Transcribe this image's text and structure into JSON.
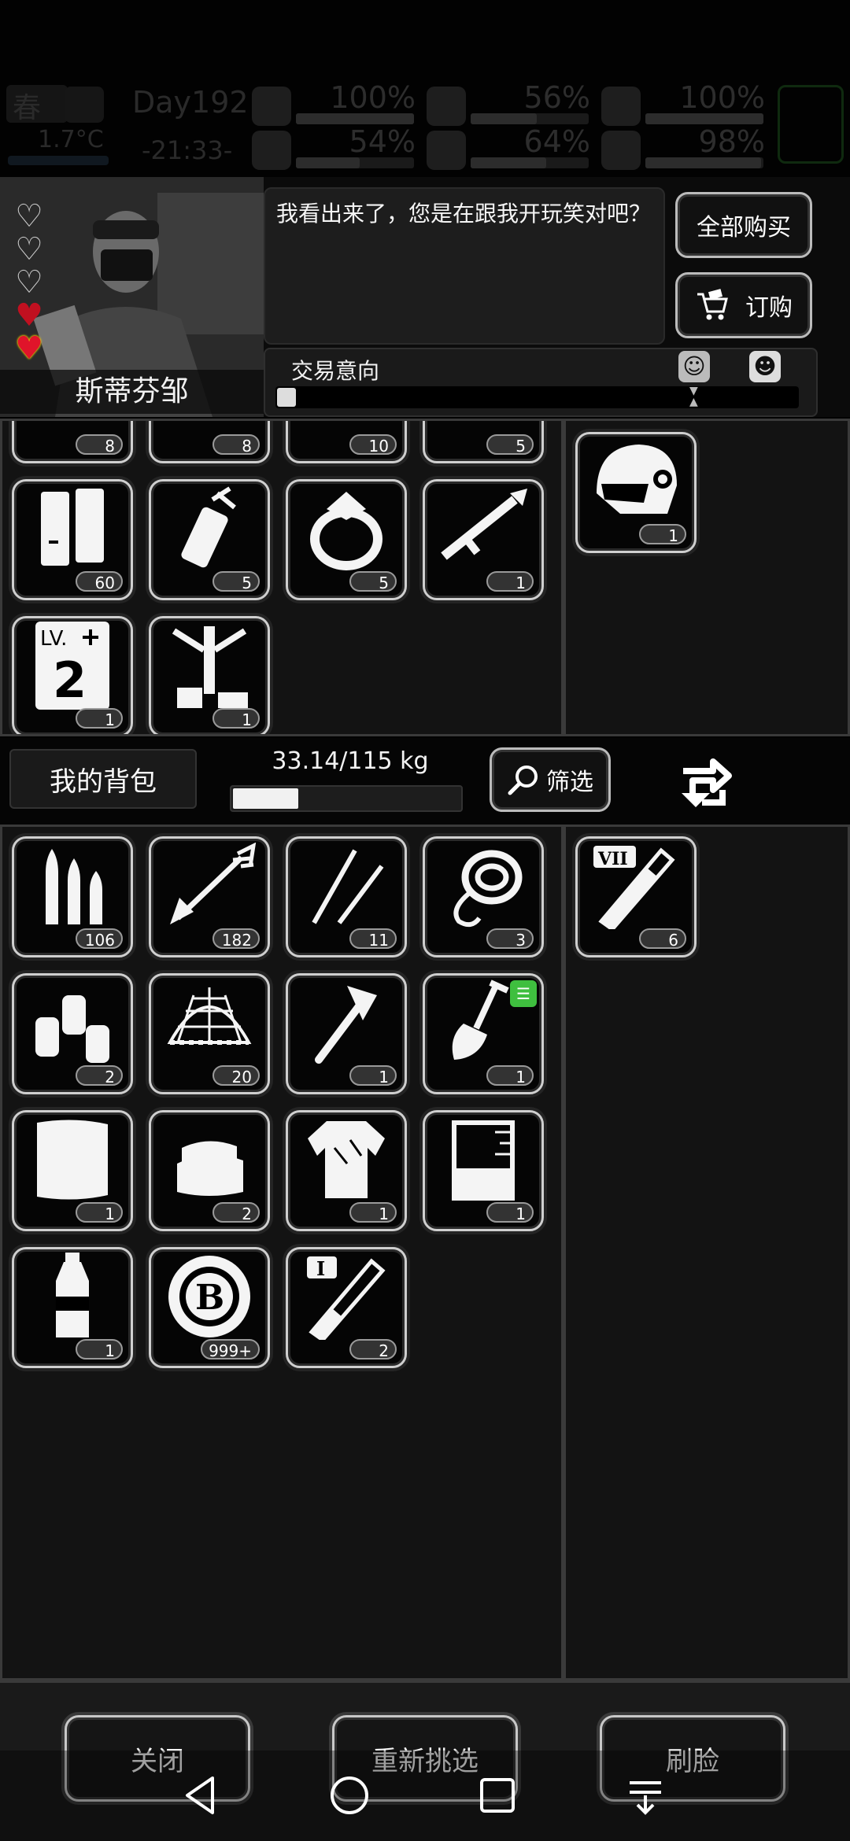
{
  "status": {
    "season": "春",
    "temperature": "1.7°C",
    "day": "Day192",
    "time": "-21:33-",
    "stats": [
      {
        "icon": "medkit-icon",
        "percent": "100%",
        "level": 1.0
      },
      {
        "icon": "stomach-icon",
        "percent": "56%",
        "level": 0.56
      },
      {
        "icon": "pill-icon",
        "percent": "100%",
        "level": 1.0
      },
      {
        "icon": "boot-icon",
        "percent": "54%",
        "level": 0.54
      },
      {
        "icon": "water-drop-icon",
        "percent": "64%",
        "level": 0.64
      },
      {
        "icon": "heart-icon",
        "percent": "98%",
        "level": 0.98
      }
    ]
  },
  "npc": {
    "name": "斯蒂芬邹",
    "dialog": "我看出来了，您是在跟我开玩笑对吧？",
    "hearts_filled": 2,
    "hearts_total": 5,
    "buy_all_label": "全部购买",
    "order_label": "订购",
    "intent_label": "交易意向",
    "intent_level": 0.03
  },
  "trader_items": [
    {
      "icon": "partial-item-icon",
      "count": "8"
    },
    {
      "icon": "partial-item-icon",
      "count": "8"
    },
    {
      "icon": "partial-item-icon",
      "count": "10"
    },
    {
      "icon": "partial-item-icon",
      "count": "5"
    },
    {
      "icon": "battery-icon",
      "count": "60"
    },
    {
      "icon": "grenade-icon",
      "count": "5"
    },
    {
      "icon": "ring-icon",
      "count": "5"
    },
    {
      "icon": "rocket-launcher-icon",
      "count": "1"
    },
    {
      "icon": "manual-lv2-icon",
      "count": "1",
      "label": "LV. 2"
    },
    {
      "icon": "tool-kit-icon",
      "count": "1"
    }
  ],
  "trader_offer": [
    {
      "icon": "helmet-icon",
      "count": "1"
    }
  ],
  "bag": {
    "label": "我的背包",
    "weight": "33.14/115 kg",
    "weight_level": 0.288,
    "filter_label": "筛选"
  },
  "bag_items": [
    {
      "icon": "bullets-icon",
      "count": "106"
    },
    {
      "icon": "arrow-icon",
      "count": "182"
    },
    {
      "icon": "needles-icon",
      "count": "11"
    },
    {
      "icon": "rope-icon",
      "count": "3"
    },
    {
      "icon": "spray-cans-icon",
      "count": "2"
    },
    {
      "icon": "net-icon",
      "count": "20"
    },
    {
      "icon": "axe-icon",
      "count": "1"
    },
    {
      "icon": "shovel-icon",
      "count": "1",
      "badge": "☰"
    },
    {
      "icon": "cloth-icon",
      "count": "1"
    },
    {
      "icon": "towels-icon",
      "count": "2"
    },
    {
      "icon": "shirt-icon",
      "count": "1"
    },
    {
      "icon": "beaker-icon",
      "count": "1"
    },
    {
      "icon": "bottle-icon",
      "count": "1"
    },
    {
      "icon": "coin-icon",
      "count": "999+"
    },
    {
      "icon": "test-tube-i-icon",
      "count": "2",
      "label": "I"
    }
  ],
  "bag_offer": [
    {
      "icon": "test-tube-vii-icon",
      "count": "6",
      "label": "VII"
    }
  ],
  "bottom": {
    "close_label": "关闭",
    "reselect_label": "重新挑选",
    "refresh_label": "刷脸"
  }
}
